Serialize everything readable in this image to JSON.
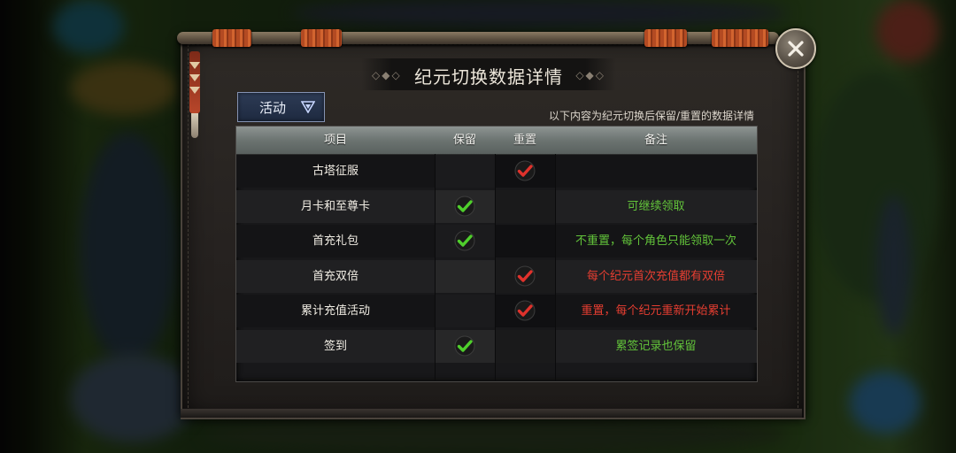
{
  "dialog": {
    "title": "纪元切换数据详情",
    "hint": "以下内容为纪元切换后保留/重置的数据详情"
  },
  "dropdown": {
    "selected": "活动"
  },
  "table": {
    "headers": {
      "item": "项目",
      "keep": "保留",
      "reset": "重置",
      "note": "备注"
    },
    "rows": [
      {
        "item": "古塔征服",
        "keep": false,
        "reset": true,
        "note": "",
        "note_color": ""
      },
      {
        "item": "月卡和至尊卡",
        "keep": true,
        "reset": false,
        "note": "可继续领取",
        "note_color": "green"
      },
      {
        "item": "首充礼包",
        "keep": true,
        "reset": false,
        "note": "不重置，每个角色只能领取一次",
        "note_color": "green"
      },
      {
        "item": "首充双倍",
        "keep": false,
        "reset": true,
        "note": "每个纪元首次充值都有双倍",
        "note_color": "red"
      },
      {
        "item": "累计充值活动",
        "keep": false,
        "reset": true,
        "note": "重置，每个纪元重新开始累计",
        "note_color": "red"
      },
      {
        "item": "签到",
        "keep": true,
        "reset": false,
        "note": "累签记录也保留",
        "note_color": "green"
      }
    ]
  },
  "colors": {
    "keep_check": "#4fcf2c",
    "reset_check": "#e0322c",
    "note_green": "#62c33a",
    "note_red": "#e63e31"
  },
  "icons": {
    "close": "close-icon",
    "dropdown": "chevron-down-icon",
    "keep": "green-check-icon",
    "reset": "red-check-icon"
  }
}
